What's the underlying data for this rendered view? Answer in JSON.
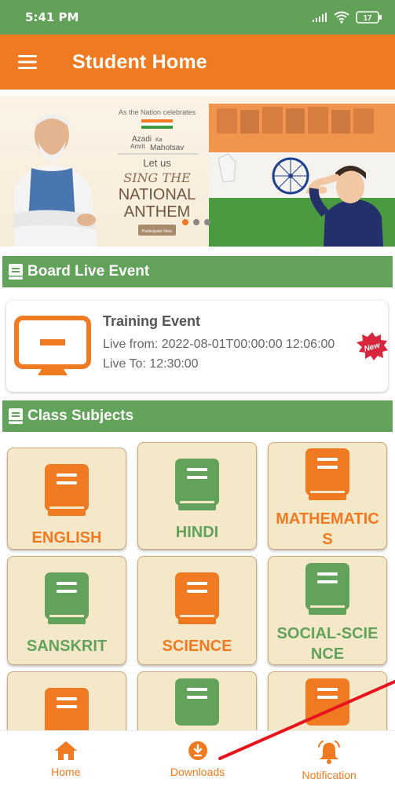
{
  "status_bar": {
    "time": "5:41 PM",
    "battery": "17"
  },
  "app_bar": {
    "title": "Student Home"
  },
  "banner": {
    "line1": "As the Nation celebrates",
    "azadi": "Azadi",
    "ka": "Ka",
    "amrit": "Amrit",
    "mahotsav": "Mahotsav",
    "let_us": "Let us",
    "sing_the": "SING THE",
    "national": "NATIONAL",
    "anthem": "ANTHEM",
    "participate": "Participate Now",
    "slides": 3,
    "active_slide": 1
  },
  "board_section": {
    "title": "Board Live Event"
  },
  "event": {
    "title": "Training Event",
    "live_from": "Live from: 2022-08-01T00:00:00 12:06:00",
    "live_to": "Live To: 12:30:00",
    "badge": "New"
  },
  "subjects_section": {
    "title": "Class Subjects"
  },
  "subjects": [
    {
      "label": "ENGLISH",
      "color": "#f07a21"
    },
    {
      "label": "HINDI",
      "color": "#62a25b"
    },
    {
      "label": "MATHEMATICS",
      "color": "#f07a21"
    },
    {
      "label": "SANSKRIT",
      "color": "#62a25b"
    },
    {
      "label": "SCIENCE",
      "color": "#f07a21"
    },
    {
      "label": "SOCIAL-SCIENCE",
      "color": "#62a25b"
    }
  ],
  "bottom_nav": [
    {
      "label": "Home",
      "icon": "home-icon"
    },
    {
      "label": "Downloads",
      "icon": "download-icon"
    },
    {
      "label": "Notification",
      "icon": "bell-icon"
    }
  ],
  "colors": {
    "primary_orange": "#f07a21",
    "primary_green": "#62a25b",
    "card_bg": "#f5e8c8"
  }
}
